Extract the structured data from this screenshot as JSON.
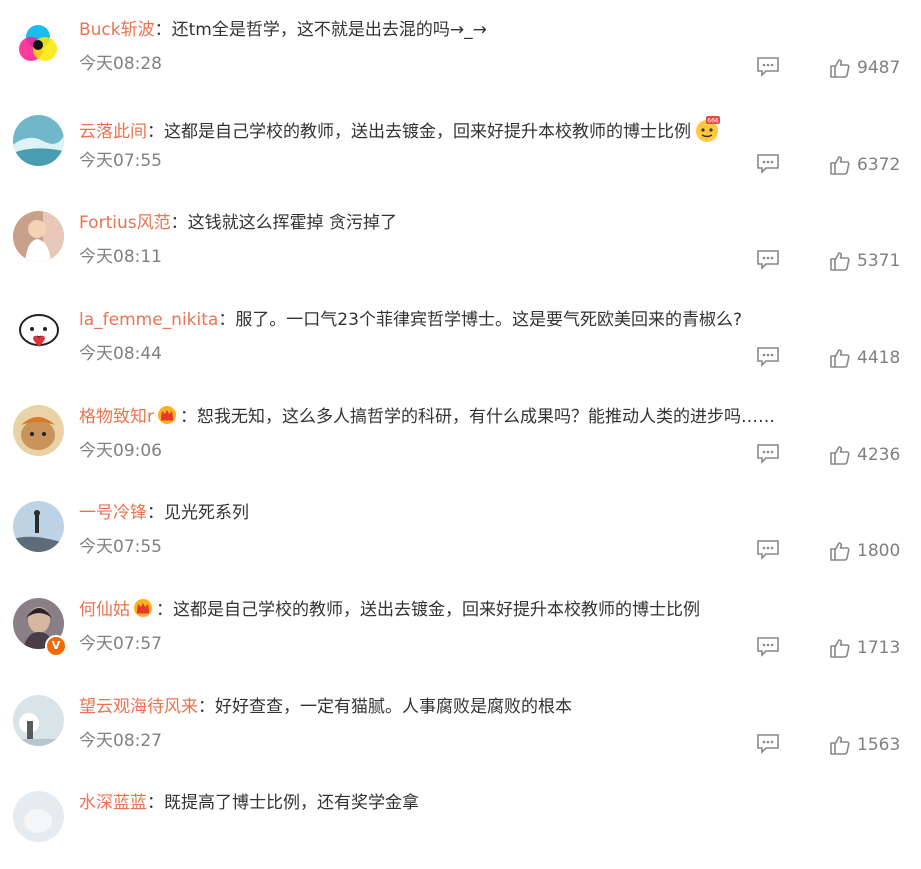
{
  "separator": "：",
  "comments": [
    {
      "user": "Buck斩波",
      "text": "还tm全是哲学，这不就是出去混的吗→_→",
      "time": "今天08:28",
      "likes": "9487"
    },
    {
      "user": "云落此间",
      "text": "这都是自己学校的教师，送出去镀金，回来好提升本校教师的博士比例",
      "time": "今天07:55",
      "likes": "6372",
      "emoji": "666-emoji-icon"
    },
    {
      "user": "Fortius风范",
      "text": "这钱就这么挥霍掉 贪污掉了",
      "time": "今天08:11",
      "likes": "5371"
    },
    {
      "user": "la_femme_nikita",
      "text": "服了。一口气23个菲律宾哲学博士。这是要气死欧美回来的青椒么?",
      "time": "今天08:44",
      "likes": "4418"
    },
    {
      "user": "格物致知r",
      "text": "恕我无知，这么多人搞哲学的科研，有什么成果吗？能推动人类的进步吗……",
      "time": "今天09:06",
      "likes": "4236",
      "badge": "crown-badge-icon"
    },
    {
      "user": "一号冷锋",
      "text": "见光死系列",
      "time": "今天07:55",
      "likes": "1800"
    },
    {
      "user": "何仙姑",
      "text": "这都是自己学校的教师，送出去镀金，回来好提升本校教师的博士比例",
      "time": "今天07:57",
      "likes": "1713",
      "badge": "crown-badge-icon",
      "verified": "V"
    },
    {
      "user": "望云观海待风来",
      "text": "好好查查，一定有猫腻。人事腐败是腐败的根本",
      "time": "今天08:27",
      "likes": "1563"
    },
    {
      "user": "水深蓝蓝",
      "text": "既提高了博士比例，还有奖学金拿",
      "time": "",
      "likes": ""
    }
  ],
  "colors": {
    "username": "#eb7350",
    "text": "#333333",
    "meta": "#808080"
  }
}
